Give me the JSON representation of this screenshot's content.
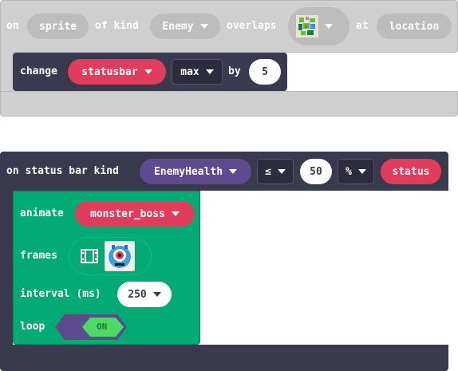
{
  "block1": {
    "words": {
      "on": "on",
      "of_kind": "of kind",
      "overlaps": "overlaps",
      "at": "at"
    },
    "sprite_param": "sprite",
    "kind_dropdown": "Enemy",
    "image_icon": "pixel-art-thumbnail-icon",
    "location_param": "location",
    "inner": {
      "change": "change",
      "statusbar_var": "statusbar",
      "field_dropdown": "max",
      "by": "by",
      "amount": "5"
    }
  },
  "block2": {
    "header": "on status bar kind",
    "kind_dropdown": "EnemyHealth",
    "op_dropdown": "≤",
    "threshold": "50",
    "unit_dropdown": "%",
    "status_param": "status",
    "animate": {
      "label": "animate",
      "sprite_var": "monster_boss",
      "frames_label": "frames",
      "frames_icon": "film-strip-icon",
      "frame_thumb": "cyclops-monster-icon",
      "interval_label": "interval (ms)",
      "interval_value": "250",
      "loop_label": "loop",
      "loop_value": "ON"
    }
  },
  "colors": {
    "hat_disabled": "#cfcfcf",
    "hat_outline": "#b8b8b8",
    "sprites_block": "#3a3a4e",
    "statusbar_var": "#e23c5c",
    "animation_green": "#03aa74",
    "kind_purple": "#5e4b8f",
    "toggle_green": "#4cd964"
  }
}
